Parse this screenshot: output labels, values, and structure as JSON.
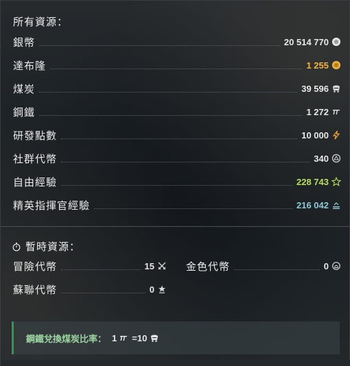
{
  "all_resources": {
    "title": "所有資源：",
    "items": [
      {
        "label": "銀幣",
        "value": "20 514 770",
        "icon": "silver-coin-icon",
        "color": "#e8e8e8"
      },
      {
        "label": "達布隆",
        "value": "1 255",
        "icon": "gold-doubloon-icon",
        "color": "#f2b23c"
      },
      {
        "label": "煤炭",
        "value": "39 596",
        "icon": "coal-cart-icon",
        "color": "#e8e8e8"
      },
      {
        "label": "鋼鐵",
        "value": "1 272",
        "icon": "steel-beam-icon",
        "color": "#e8e8e8"
      },
      {
        "label": "研發點數",
        "value": "10 000",
        "icon": "lightning-icon",
        "color": "#e8e8e8"
      },
      {
        "label": "社群代幣",
        "value": "340",
        "icon": "community-token-icon",
        "color": "#e8e8e8"
      },
      {
        "label": "自由經驗",
        "value": "228 743",
        "icon": "star-icon",
        "color": "#b5e05a"
      },
      {
        "label": "精英指揮官經驗",
        "value": "216 042",
        "icon": "commander-xp-icon",
        "color": "#8ec8d6"
      }
    ]
  },
  "temporary_resources": {
    "title": "暫時資源：",
    "icon": "stopwatch-icon",
    "items": [
      {
        "label": "冒險代幣",
        "value": "15",
        "icon": "crossed-swords-icon"
      },
      {
        "label": "金色代幣",
        "value": "0",
        "icon": "gold-token-icon"
      },
      {
        "label": "蘇聯代幣",
        "value": "0",
        "icon": "soviet-star-icon"
      }
    ]
  },
  "exchange_rate": {
    "label": "鋼鐵兌換煤炭比率：",
    "left_value": "1",
    "right_value": "=10",
    "left_icon": "steel-beam-icon",
    "right_icon": "coal-cart-icon",
    "accent": "#2e9a4a"
  }
}
